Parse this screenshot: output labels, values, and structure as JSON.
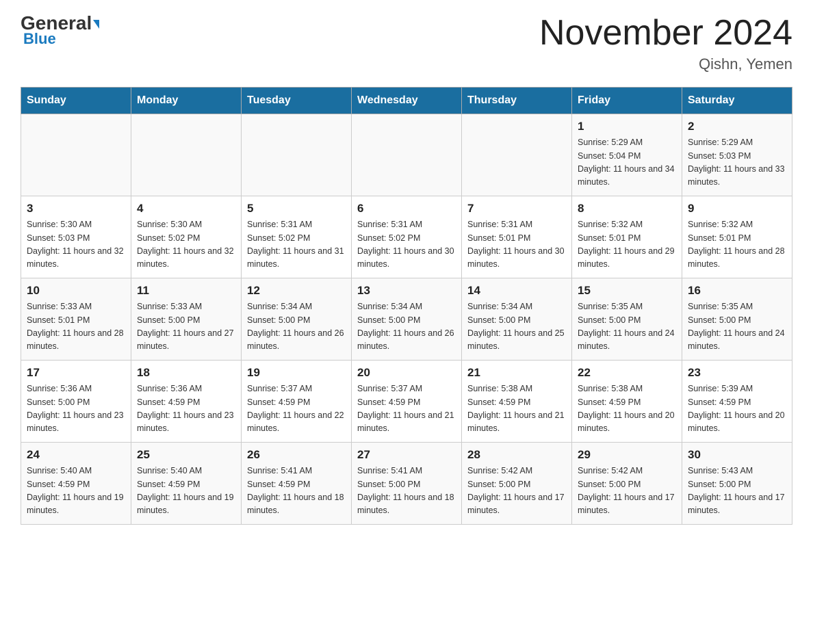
{
  "header": {
    "logo_general": "General",
    "logo_blue": "Blue",
    "month_year": "November 2024",
    "location": "Qishn, Yemen"
  },
  "days_of_week": [
    "Sunday",
    "Monday",
    "Tuesday",
    "Wednesday",
    "Thursday",
    "Friday",
    "Saturday"
  ],
  "weeks": [
    [
      {
        "day": "",
        "sunrise": "",
        "sunset": "",
        "daylight": ""
      },
      {
        "day": "",
        "sunrise": "",
        "sunset": "",
        "daylight": ""
      },
      {
        "day": "",
        "sunrise": "",
        "sunset": "",
        "daylight": ""
      },
      {
        "day": "",
        "sunrise": "",
        "sunset": "",
        "daylight": ""
      },
      {
        "day": "",
        "sunrise": "",
        "sunset": "",
        "daylight": ""
      },
      {
        "day": "1",
        "sunrise": "Sunrise: 5:29 AM",
        "sunset": "Sunset: 5:04 PM",
        "daylight": "Daylight: 11 hours and 34 minutes."
      },
      {
        "day": "2",
        "sunrise": "Sunrise: 5:29 AM",
        "sunset": "Sunset: 5:03 PM",
        "daylight": "Daylight: 11 hours and 33 minutes."
      }
    ],
    [
      {
        "day": "3",
        "sunrise": "Sunrise: 5:30 AM",
        "sunset": "Sunset: 5:03 PM",
        "daylight": "Daylight: 11 hours and 32 minutes."
      },
      {
        "day": "4",
        "sunrise": "Sunrise: 5:30 AM",
        "sunset": "Sunset: 5:02 PM",
        "daylight": "Daylight: 11 hours and 32 minutes."
      },
      {
        "day": "5",
        "sunrise": "Sunrise: 5:31 AM",
        "sunset": "Sunset: 5:02 PM",
        "daylight": "Daylight: 11 hours and 31 minutes."
      },
      {
        "day": "6",
        "sunrise": "Sunrise: 5:31 AM",
        "sunset": "Sunset: 5:02 PM",
        "daylight": "Daylight: 11 hours and 30 minutes."
      },
      {
        "day": "7",
        "sunrise": "Sunrise: 5:31 AM",
        "sunset": "Sunset: 5:01 PM",
        "daylight": "Daylight: 11 hours and 30 minutes."
      },
      {
        "day": "8",
        "sunrise": "Sunrise: 5:32 AM",
        "sunset": "Sunset: 5:01 PM",
        "daylight": "Daylight: 11 hours and 29 minutes."
      },
      {
        "day": "9",
        "sunrise": "Sunrise: 5:32 AM",
        "sunset": "Sunset: 5:01 PM",
        "daylight": "Daylight: 11 hours and 28 minutes."
      }
    ],
    [
      {
        "day": "10",
        "sunrise": "Sunrise: 5:33 AM",
        "sunset": "Sunset: 5:01 PM",
        "daylight": "Daylight: 11 hours and 28 minutes."
      },
      {
        "day": "11",
        "sunrise": "Sunrise: 5:33 AM",
        "sunset": "Sunset: 5:00 PM",
        "daylight": "Daylight: 11 hours and 27 minutes."
      },
      {
        "day": "12",
        "sunrise": "Sunrise: 5:34 AM",
        "sunset": "Sunset: 5:00 PM",
        "daylight": "Daylight: 11 hours and 26 minutes."
      },
      {
        "day": "13",
        "sunrise": "Sunrise: 5:34 AM",
        "sunset": "Sunset: 5:00 PM",
        "daylight": "Daylight: 11 hours and 26 minutes."
      },
      {
        "day": "14",
        "sunrise": "Sunrise: 5:34 AM",
        "sunset": "Sunset: 5:00 PM",
        "daylight": "Daylight: 11 hours and 25 minutes."
      },
      {
        "day": "15",
        "sunrise": "Sunrise: 5:35 AM",
        "sunset": "Sunset: 5:00 PM",
        "daylight": "Daylight: 11 hours and 24 minutes."
      },
      {
        "day": "16",
        "sunrise": "Sunrise: 5:35 AM",
        "sunset": "Sunset: 5:00 PM",
        "daylight": "Daylight: 11 hours and 24 minutes."
      }
    ],
    [
      {
        "day": "17",
        "sunrise": "Sunrise: 5:36 AM",
        "sunset": "Sunset: 5:00 PM",
        "daylight": "Daylight: 11 hours and 23 minutes."
      },
      {
        "day": "18",
        "sunrise": "Sunrise: 5:36 AM",
        "sunset": "Sunset: 4:59 PM",
        "daylight": "Daylight: 11 hours and 23 minutes."
      },
      {
        "day": "19",
        "sunrise": "Sunrise: 5:37 AM",
        "sunset": "Sunset: 4:59 PM",
        "daylight": "Daylight: 11 hours and 22 minutes."
      },
      {
        "day": "20",
        "sunrise": "Sunrise: 5:37 AM",
        "sunset": "Sunset: 4:59 PM",
        "daylight": "Daylight: 11 hours and 21 minutes."
      },
      {
        "day": "21",
        "sunrise": "Sunrise: 5:38 AM",
        "sunset": "Sunset: 4:59 PM",
        "daylight": "Daylight: 11 hours and 21 minutes."
      },
      {
        "day": "22",
        "sunrise": "Sunrise: 5:38 AM",
        "sunset": "Sunset: 4:59 PM",
        "daylight": "Daylight: 11 hours and 20 minutes."
      },
      {
        "day": "23",
        "sunrise": "Sunrise: 5:39 AM",
        "sunset": "Sunset: 4:59 PM",
        "daylight": "Daylight: 11 hours and 20 minutes."
      }
    ],
    [
      {
        "day": "24",
        "sunrise": "Sunrise: 5:40 AM",
        "sunset": "Sunset: 4:59 PM",
        "daylight": "Daylight: 11 hours and 19 minutes."
      },
      {
        "day": "25",
        "sunrise": "Sunrise: 5:40 AM",
        "sunset": "Sunset: 4:59 PM",
        "daylight": "Daylight: 11 hours and 19 minutes."
      },
      {
        "day": "26",
        "sunrise": "Sunrise: 5:41 AM",
        "sunset": "Sunset: 4:59 PM",
        "daylight": "Daylight: 11 hours and 18 minutes."
      },
      {
        "day": "27",
        "sunrise": "Sunrise: 5:41 AM",
        "sunset": "Sunset: 5:00 PM",
        "daylight": "Daylight: 11 hours and 18 minutes."
      },
      {
        "day": "28",
        "sunrise": "Sunrise: 5:42 AM",
        "sunset": "Sunset: 5:00 PM",
        "daylight": "Daylight: 11 hours and 17 minutes."
      },
      {
        "day": "29",
        "sunrise": "Sunrise: 5:42 AM",
        "sunset": "Sunset: 5:00 PM",
        "daylight": "Daylight: 11 hours and 17 minutes."
      },
      {
        "day": "30",
        "sunrise": "Sunrise: 5:43 AM",
        "sunset": "Sunset: 5:00 PM",
        "daylight": "Daylight: 11 hours and 17 minutes."
      }
    ]
  ]
}
